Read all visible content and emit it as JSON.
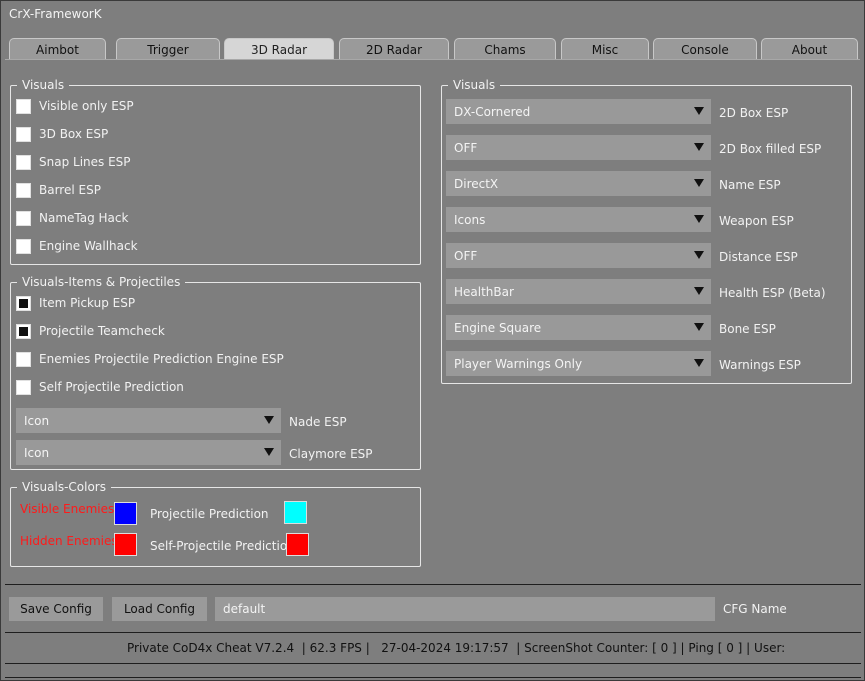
{
  "window": {
    "title": "CrX-FrameworK"
  },
  "tabs": [
    {
      "label": "Aimbot"
    },
    {
      "label": "Trigger"
    },
    {
      "label": "3D Radar",
      "active": true
    },
    {
      "label": "2D Radar"
    },
    {
      "label": "Chams"
    },
    {
      "label": "Misc"
    },
    {
      "label": "Console"
    },
    {
      "label": "About"
    }
  ],
  "visuals_left": {
    "title": "Visuals",
    "items": [
      {
        "label": "Visible only ESP",
        "checked": false
      },
      {
        "label": "3D Box ESP",
        "checked": false
      },
      {
        "label": "Snap Lines ESP",
        "checked": false
      },
      {
        "label": "Barrel ESP",
        "checked": false
      },
      {
        "label": "NameTag Hack",
        "checked": false
      },
      {
        "label": "Engine Wallhack",
        "checked": false
      }
    ]
  },
  "items_projectiles": {
    "title": "Visuals-Items & Projectiles",
    "items": [
      {
        "label": "Item Pickup ESP",
        "checked": true
      },
      {
        "label": "Projectile Teamcheck",
        "checked": true
      },
      {
        "label": "Enemies Projectile Prediction Engine ESP",
        "checked": false
      },
      {
        "label": "Self Projectile Prediction",
        "checked": false
      }
    ],
    "selects": [
      {
        "value": "Icon",
        "label": "Nade ESP"
      },
      {
        "value": "Icon",
        "label": "Claymore ESP"
      }
    ]
  },
  "colors": {
    "title": "Visuals-Colors",
    "visible_enemies": {
      "label": "Visible Enemies",
      "color": "#0000ff"
    },
    "hidden_enemies": {
      "label": "Hidden Enemies",
      "color": "#ff0000"
    },
    "projectile_prediction": {
      "label": "Projectile Prediction",
      "color": "#00ffff"
    },
    "self_projectile_prediction": {
      "label": "Self-Projectile Prediction",
      "color": "#ff0000"
    },
    "label_red": "#ff1a1a"
  },
  "visuals_right": {
    "title": "Visuals",
    "selects": [
      {
        "value": "DX-Cornered",
        "label": "2D Box ESP"
      },
      {
        "value": "OFF",
        "label": "2D Box filled ESP"
      },
      {
        "value": "DirectX",
        "label": "Name ESP"
      },
      {
        "value": "Icons",
        "label": "Weapon ESP"
      },
      {
        "value": "OFF",
        "label": "Distance ESP"
      },
      {
        "value": "HealthBar",
        "label": "Health ESP (Beta)"
      },
      {
        "value": "Engine Square",
        "label": "Bone ESP"
      },
      {
        "value": "Player Warnings Only",
        "label": "Warnings ESP"
      }
    ]
  },
  "config": {
    "save_label": "Save Config",
    "load_label": "Load Config",
    "name_value": "default",
    "name_label": "CFG Name"
  },
  "status_bar": {
    "text": "Private CoD4x Cheat V7.2.4  | 62.3 FPS |   27-04-2024 19:17:57  | ScreenShot Counter: [ 0 ] | Ping [ 0 ] | User:"
  }
}
